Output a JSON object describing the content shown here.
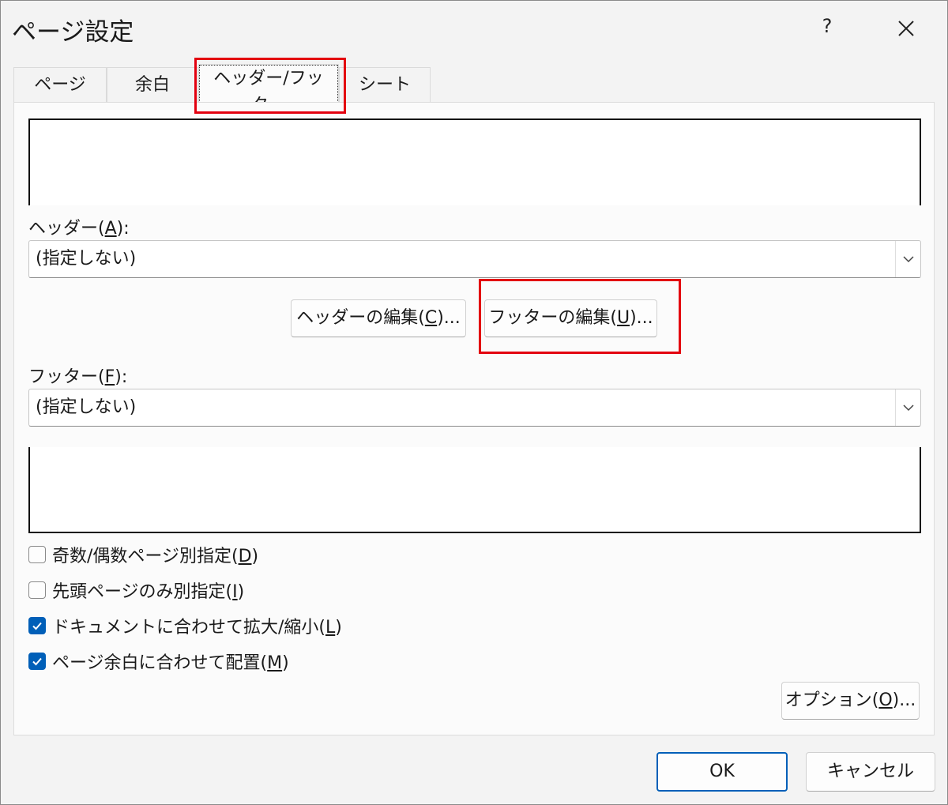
{
  "window": {
    "title": "ページ設定",
    "help_label": "?"
  },
  "tabs": [
    {
      "label": "ページ"
    },
    {
      "label": "余白"
    },
    {
      "label": "ヘッダー/フッター",
      "active": true
    },
    {
      "label": "シート"
    }
  ],
  "header": {
    "label_prefix": "ヘッダー(",
    "label_key": "A",
    "label_suffix": "):",
    "value": "(指定しない)"
  },
  "buttons": {
    "edit_header": {
      "prefix": "ヘッダーの編集(",
      "key": "C",
      "suffix": ")..."
    },
    "edit_footer": {
      "prefix": "フッターの編集(",
      "key": "U",
      "suffix": ")..."
    },
    "options": {
      "prefix": "オプション(",
      "key": "O",
      "suffix": ")..."
    },
    "ok": "OK",
    "cancel": "キャンセル"
  },
  "footer": {
    "label_prefix": "フッター(",
    "label_key": "F",
    "label_suffix": "):",
    "value": "(指定しない)"
  },
  "checkboxes": [
    {
      "prefix": "奇数/偶数ページ別指定(",
      "key": "D",
      "suffix": ")",
      "checked": false
    },
    {
      "prefix": "先頭ページのみ別指定(",
      "key": "I",
      "suffix": ")",
      "checked": false
    },
    {
      "prefix": "ドキュメントに合わせて拡大/縮小(",
      "key": "L",
      "suffix": ")",
      "checked": true
    },
    {
      "prefix": "ページ余白に合わせて配置(",
      "key": "M",
      "suffix": ")",
      "checked": true
    }
  ],
  "colors": {
    "accent": "#005fb8",
    "highlight": "#e3000f"
  }
}
